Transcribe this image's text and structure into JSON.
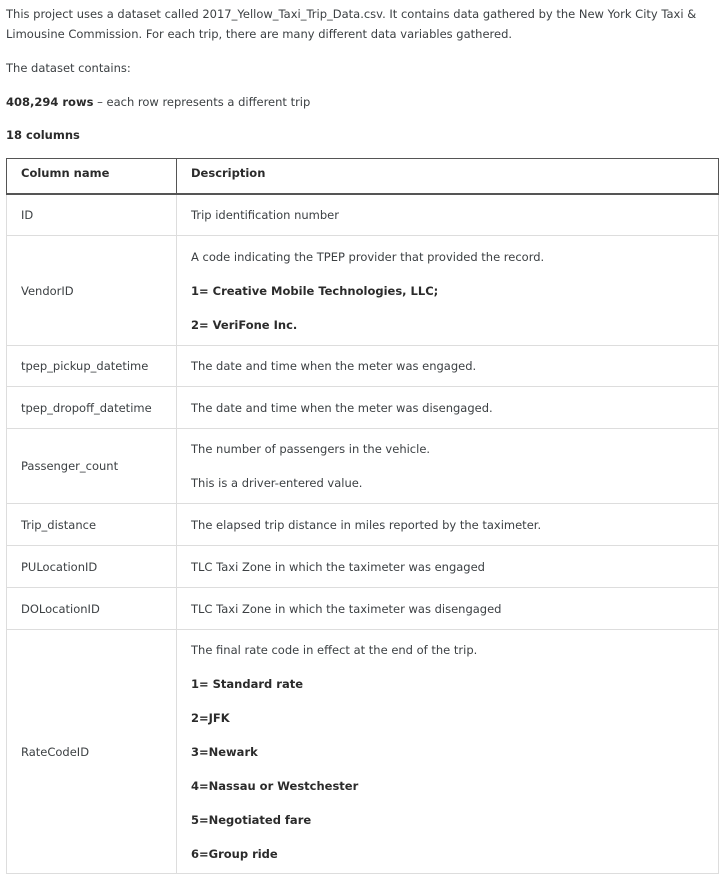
{
  "intro": {
    "paragraph": "This project uses a dataset called 2017_Yellow_Taxi_Trip_Data.csv. It contains data gathered by the New York City Taxi & Limousine Commission. For each trip, there are many different data variables gathered.",
    "contains": "The dataset contains:",
    "rows_count": "408,294 rows",
    "rows_text": " – each row represents a different trip",
    "columns_count": "18 columns"
  },
  "table": {
    "headers": [
      "Column name",
      "Description"
    ],
    "rows": [
      {
        "name": "ID",
        "desc": [
          "Trip identification number"
        ]
      },
      {
        "name": "VendorID",
        "desc": [
          "A code indicating the TPEP provider that provided the record.",
          "1= Creative Mobile Technologies, LLC;",
          "2= VeriFone Inc."
        ]
      },
      {
        "name": "tpep_pickup_datetime",
        "desc": [
          "The date and time when the meter was engaged."
        ]
      },
      {
        "name": "tpep_dropoff_datetime",
        "desc": [
          "The date and time when the meter was disengaged."
        ]
      },
      {
        "name": "Passenger_count",
        "desc": [
          "The number of passengers in the vehicle.",
          "This is a driver-entered value."
        ]
      },
      {
        "name": "Trip_distance",
        "desc": [
          "The elapsed trip distance in miles reported by the taximeter."
        ]
      },
      {
        "name": "PULocationID",
        "desc": [
          "TLC Taxi Zone in which the taximeter was engaged"
        ]
      },
      {
        "name": "DOLocationID",
        "desc": [
          "TLC Taxi Zone in which the taximeter was disengaged"
        ]
      },
      {
        "name": "RateCodeID",
        "desc": [
          "The final rate code in effect at the end of the trip.",
          "1= Standard rate",
          "2=JFK",
          "3=Newark",
          "4=Nassau or Westchester",
          "5=Negotiated fare",
          "6=Group ride"
        ]
      }
    ]
  }
}
